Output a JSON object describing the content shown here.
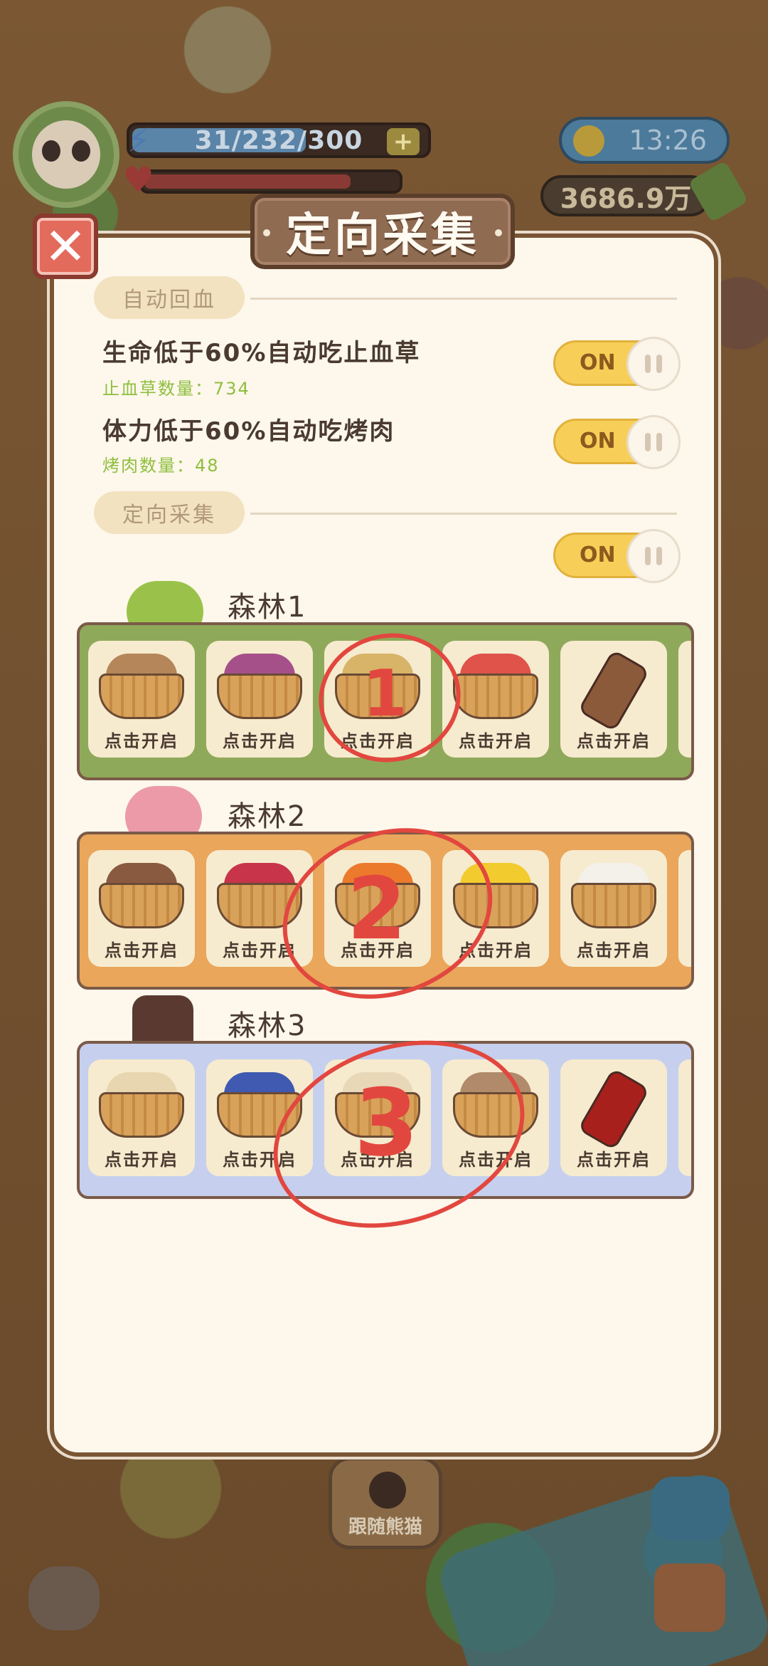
{
  "hud": {
    "energy": "31/232/300",
    "plus": "+",
    "time": "13:26",
    "money": "3686.9万",
    "follow_label": "跟随熊猫"
  },
  "modal": {
    "title": "定向采集",
    "close": "✕",
    "auto_heal": {
      "section_label": "自动回血",
      "rows": [
        {
          "title": "生命低于60%自动吃止血草",
          "sub": "止血草数量：734",
          "toggle": "ON"
        },
        {
          "title": "体力低于60%自动吃烤肉",
          "sub": "烤肉数量：48",
          "toggle": "ON"
        }
      ]
    },
    "directed": {
      "section_label": "定向采集",
      "toggle": "ON"
    },
    "forests": [
      {
        "name": "森林1",
        "panel_color": "#8fa95a",
        "slots": [
          {
            "item": "potato-basket",
            "color": "#b4865a",
            "label": "点击开启"
          },
          {
            "item": "purple-flower-basket",
            "color": "#a6508a",
            "label": "点击开启"
          },
          {
            "item": "egg-basket",
            "color": "#d7b468",
            "label": "点击开启"
          },
          {
            "item": "apple-basket",
            "color": "#e0534a",
            "label": "点击开启"
          },
          {
            "item": "wood-log",
            "color": "#8a5a3a",
            "label": "点击开启"
          }
        ]
      },
      {
        "name": "森林2",
        "panel_color": "#eaa65a",
        "slots": [
          {
            "item": "chestnut-basket",
            "color": "#8a5a40",
            "label": "点击开启"
          },
          {
            "item": "raspberry-basket",
            "color": "#c8344a",
            "label": "点击开启"
          },
          {
            "item": "orange-basket",
            "color": "#ec7a2c",
            "label": "点击开启"
          },
          {
            "item": "lemon-basket",
            "color": "#f2cc2e",
            "label": "点击开启"
          },
          {
            "item": "cotton-basket",
            "color": "#f4f1ea",
            "label": "点击开启"
          }
        ]
      },
      {
        "name": "森林3",
        "panel_color": "#c6cfee",
        "slots": [
          {
            "item": "bamboo-shoot-basket",
            "color": "#e8d6b0",
            "label": "点击开启"
          },
          {
            "item": "blueberry-basket",
            "color": "#3f5ab0",
            "label": "点击开启"
          },
          {
            "item": "mushroom-basket",
            "color": "#e8d8b8",
            "label": "点击开启"
          },
          {
            "item": "root-basket",
            "color": "#b08a6a",
            "label": "点击开启"
          },
          {
            "item": "red-log",
            "color": "#a8201c",
            "label": "点击开启"
          }
        ]
      }
    ],
    "annotations": [
      "1",
      "2",
      "3"
    ]
  }
}
